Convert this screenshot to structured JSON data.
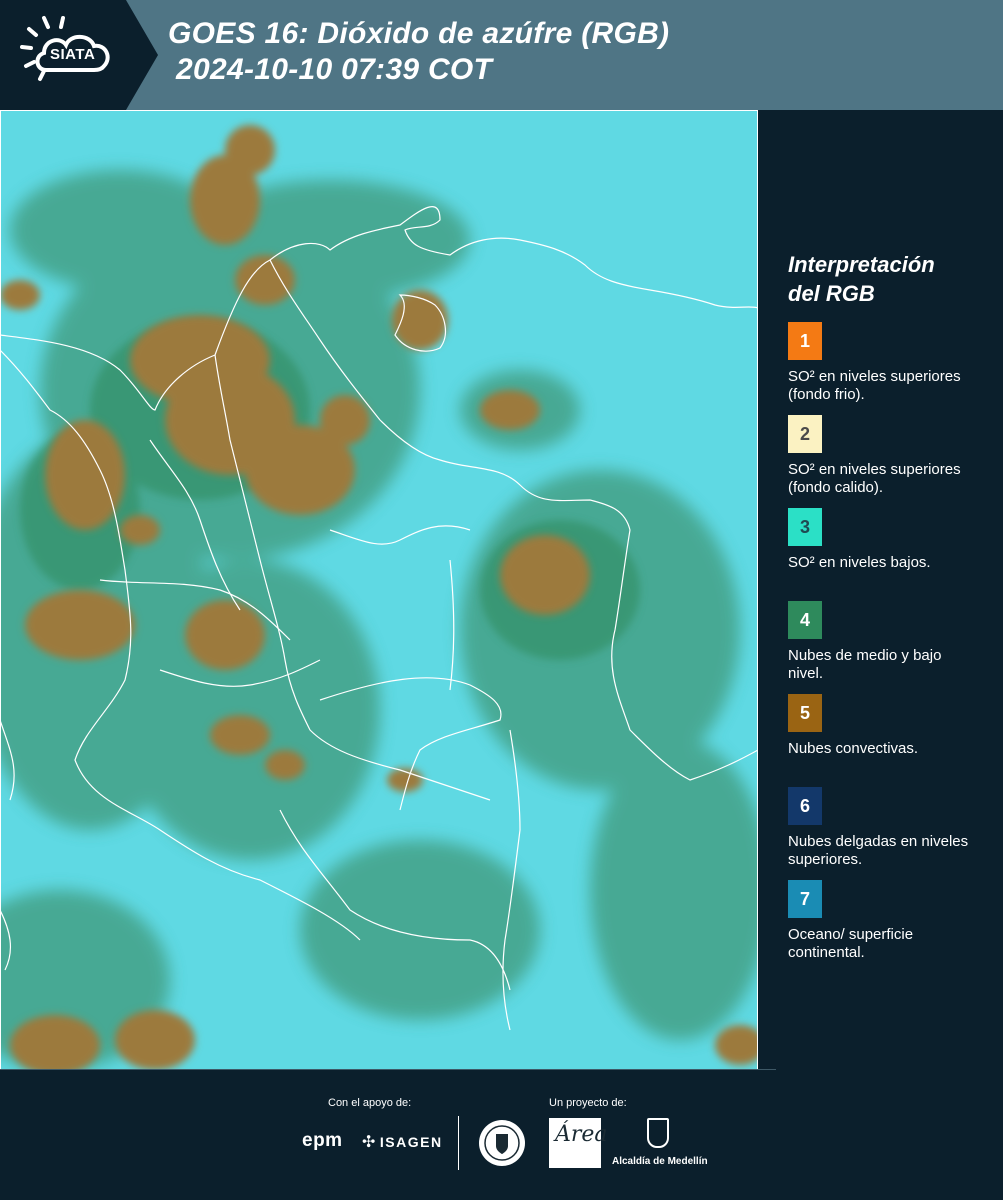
{
  "header": {
    "brand": "SIATA",
    "title_line1": "GOES 16: Dióxido de azúfre (RGB)",
    "title_line2": "2024-10-10 07:39 COT",
    "background_color": "#4f7585",
    "logo_block_color": "#0b1f2c"
  },
  "legend": {
    "title_line1": "Interpretación",
    "title_line2": "del RGB",
    "items": [
      {
        "number": "1",
        "color": "#f47a14",
        "text_color": "#ffffff",
        "text": "SO² en niveles superiores (fondo frio)."
      },
      {
        "number": "2",
        "color": "#fbf2c2",
        "text_color": "#4a4a4a",
        "text": "SO² en niveles superiores (fondo calido)."
      },
      {
        "number": "3",
        "color": "#2be0c6",
        "text_color": "#1f4a52",
        "text": "SO² en niveles bajos."
      },
      {
        "number": "4",
        "color": "#2e8a5c",
        "text_color": "#ffffff",
        "text": "Nubes de medio y bajo nivel."
      },
      {
        "number": "5",
        "color": "#9a6413",
        "text_color": "#ffffff",
        "text": "Nubes convectivas."
      },
      {
        "number": "6",
        "color": "#13386a",
        "text_color": "#ffffff",
        "text": "Nubes delgadas en niveles superiores."
      },
      {
        "number": "7",
        "color": "#1a8cb4",
        "text_color": "#ffffff",
        "text": "Oceano/ superficie continental."
      }
    ]
  },
  "map": {
    "background_color": "#5fd9e3",
    "convective_color": "#9c7a3e",
    "low_cloud_color": "#3f9a7a",
    "border_color": "#ffffff"
  },
  "footer": {
    "support_label": "Con el apoyo de:",
    "project_label": "Un proyecto de:",
    "sponsor_1": "epm",
    "sponsor_2": "ISAGEN",
    "partner_1": "Área Metropolitana Valle de Aburrá",
    "partner_2": "Alcaldía de Medellín"
  }
}
